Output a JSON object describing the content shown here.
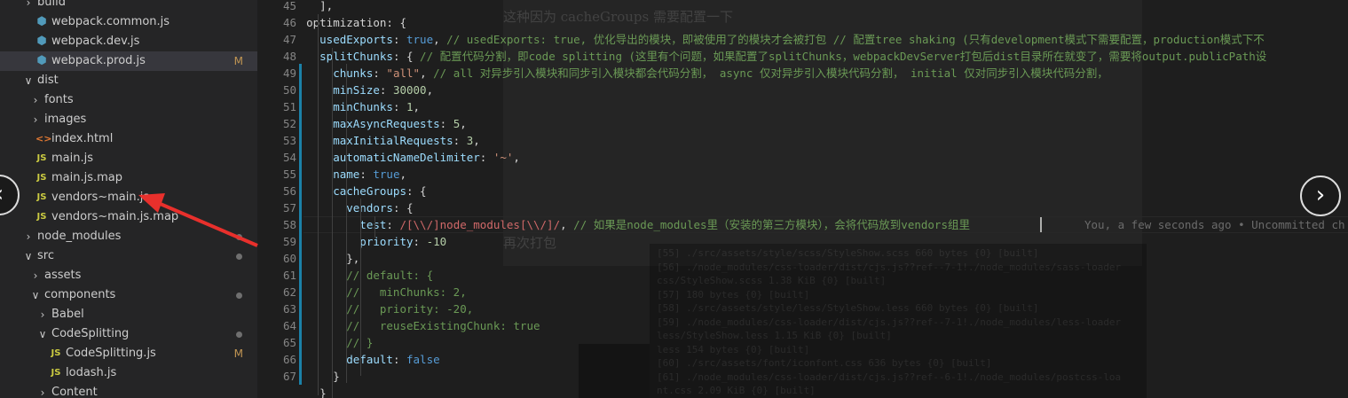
{
  "explorer": {
    "items": [
      {
        "label": "build",
        "type": "folder-closed",
        "badge": "",
        "dot": false
      },
      {
        "label": "webpack.common.js",
        "type": "webpack",
        "badge": "",
        "dot": false
      },
      {
        "label": "webpack.dev.js",
        "type": "webpack",
        "badge": "",
        "dot": false
      },
      {
        "label": "webpack.prod.js",
        "type": "webpack",
        "badge": "M",
        "dot": false,
        "selected": true
      },
      {
        "label": "dist",
        "type": "folder-open",
        "badge": "",
        "dot": false
      },
      {
        "label": "fonts",
        "type": "folder-closed",
        "badge": "",
        "dot": false
      },
      {
        "label": "images",
        "type": "folder-closed",
        "badge": "",
        "dot": false
      },
      {
        "label": "index.html",
        "type": "html",
        "badge": "",
        "dot": false
      },
      {
        "label": "main.js",
        "type": "js",
        "badge": "",
        "dot": false
      },
      {
        "label": "main.js.map",
        "type": "js",
        "badge": "",
        "dot": false
      },
      {
        "label": "vendors~main.js",
        "type": "js",
        "badge": "",
        "dot": false
      },
      {
        "label": "vendors~main.js.map",
        "type": "js",
        "badge": "",
        "dot": false
      },
      {
        "label": "node_modules",
        "type": "folder-closed",
        "badge": "",
        "dot": true
      },
      {
        "label": "src",
        "type": "folder-open",
        "badge": "",
        "dot": true
      },
      {
        "label": "assets",
        "type": "folder-closed",
        "badge": "",
        "dot": false
      },
      {
        "label": "components",
        "type": "folder-open",
        "badge": "",
        "dot": true
      },
      {
        "label": "Babel",
        "type": "folder-closed",
        "badge": "",
        "dot": false
      },
      {
        "label": "CodeSplitting",
        "type": "folder-open",
        "badge": "",
        "dot": true
      },
      {
        "label": "CodeSplitting.js",
        "type": "js",
        "badge": "M",
        "dot": false
      },
      {
        "label": "lodash.js",
        "type": "js",
        "badge": "",
        "dot": false
      },
      {
        "label": "Content",
        "type": "folder-closed",
        "badge": "",
        "dot": false
      }
    ],
    "js_icon_text": "JS",
    "html_icon_text": "<>"
  },
  "editor": {
    "line_numbers": [
      "45",
      "46",
      "47",
      "48",
      "49",
      "50",
      "51",
      "52",
      "53",
      "54",
      "55",
      "56",
      "57",
      "58",
      "59",
      "60",
      "61",
      "62",
      "63",
      "64",
      "65",
      "66",
      "67"
    ],
    "lines": [
      [
        {
          "t": "p",
          "v": "      ],"
        }
      ],
      [
        {
          "t": "p",
          "v": "    optimization: {"
        }
      ],
      [
        {
          "t": "k",
          "v": "      usedExports"
        },
        {
          "t": "p",
          "v": ": "
        },
        {
          "t": "b",
          "v": "true"
        },
        {
          "t": "p",
          "v": ", "
        },
        {
          "t": "c",
          "v": "// usedExports: true, 优化导出的模块，即被使用了的模块才会被打包 // 配置tree shaking (只有development模式下需要配置，production模式下不"
        }
      ],
      [
        {
          "t": "k",
          "v": "      splitChunks"
        },
        {
          "t": "p",
          "v": ": { "
        },
        {
          "t": "c",
          "v": "// 配置代码分割，即code splitting (这里有个问题，如果配置了splitChunks，webpackDevServer打包后dist目录所在就变了，需要将output.publicPath设"
        }
      ],
      [
        {
          "t": "k",
          "v": "        chunks"
        },
        {
          "t": "p",
          "v": ": "
        },
        {
          "t": "s",
          "v": "\"all\""
        },
        {
          "t": "p",
          "v": ", "
        },
        {
          "t": "c",
          "v": "// all 对异步引入模块和同步引入模块都会代码分割， async 仅对异步引入模块代码分割， initial 仅对同步引入模块代码分割，"
        }
      ],
      [
        {
          "t": "k",
          "v": "        minSize"
        },
        {
          "t": "p",
          "v": ": "
        },
        {
          "t": "n",
          "v": "30000"
        },
        {
          "t": "p",
          "v": ","
        }
      ],
      [
        {
          "t": "k",
          "v": "        minChunks"
        },
        {
          "t": "p",
          "v": ": "
        },
        {
          "t": "n",
          "v": "1"
        },
        {
          "t": "p",
          "v": ","
        }
      ],
      [
        {
          "t": "k",
          "v": "        maxAsyncRequests"
        },
        {
          "t": "p",
          "v": ": "
        },
        {
          "t": "n",
          "v": "5"
        },
        {
          "t": "p",
          "v": ","
        }
      ],
      [
        {
          "t": "k",
          "v": "        maxInitialRequests"
        },
        {
          "t": "p",
          "v": ": "
        },
        {
          "t": "n",
          "v": "3"
        },
        {
          "t": "p",
          "v": ","
        }
      ],
      [
        {
          "t": "k",
          "v": "        automaticNameDelimiter"
        },
        {
          "t": "p",
          "v": ": "
        },
        {
          "t": "s",
          "v": "'~'"
        },
        {
          "t": "p",
          "v": ","
        }
      ],
      [
        {
          "t": "k",
          "v": "        name"
        },
        {
          "t": "p",
          "v": ": "
        },
        {
          "t": "b",
          "v": "true"
        },
        {
          "t": "p",
          "v": ","
        }
      ],
      [
        {
          "t": "k",
          "v": "        cacheGroups"
        },
        {
          "t": "p",
          "v": ": {"
        }
      ],
      [
        {
          "t": "k",
          "v": "          vendors"
        },
        {
          "t": "p",
          "v": ": {"
        }
      ],
      [
        {
          "t": "k",
          "v": "            test"
        },
        {
          "t": "p",
          "v": ": "
        },
        {
          "t": "r",
          "v": "/[\\\\/]node_modules[\\\\/]/"
        },
        {
          "t": "p",
          "v": ", "
        },
        {
          "t": "c",
          "v": "// 如果是node_modules里（安装的第三方模块），会将代码放到vendors组里"
        }
      ],
      [
        {
          "t": "k",
          "v": "            priority"
        },
        {
          "t": "p",
          "v": ": "
        },
        {
          "t": "n",
          "v": "-10"
        }
      ],
      [
        {
          "t": "p",
          "v": "          },"
        }
      ],
      [
        {
          "t": "c",
          "v": "          // default: {"
        }
      ],
      [
        {
          "t": "c",
          "v": "          //   minChunks: 2,"
        }
      ],
      [
        {
          "t": "c",
          "v": "          //   priority: -20,"
        }
      ],
      [
        {
          "t": "c",
          "v": "          //   reuseExistingChunk: true"
        }
      ],
      [
        {
          "t": "c",
          "v": "          // }"
        }
      ],
      [
        {
          "t": "k",
          "v": "          default"
        },
        {
          "t": "p",
          "v": ": "
        },
        {
          "t": "b",
          "v": "false"
        }
      ],
      [
        {
          "t": "p",
          "v": "        }"
        }
      ]
    ],
    "overflow_line": "      }",
    "blame_text": "You, a few seconds ago • Uncommitted ch"
  },
  "overlay": {
    "heading_text": "这种因为 cacheGroups 需要配置一下",
    "repack_text": "再次打包",
    "next_icon": "chevron-right-icon",
    "prev_icon": "chevron-left-icon",
    "next_glyph": "›",
    "prev_glyph": "‹",
    "arrow_color": "#e8302c"
  }
}
